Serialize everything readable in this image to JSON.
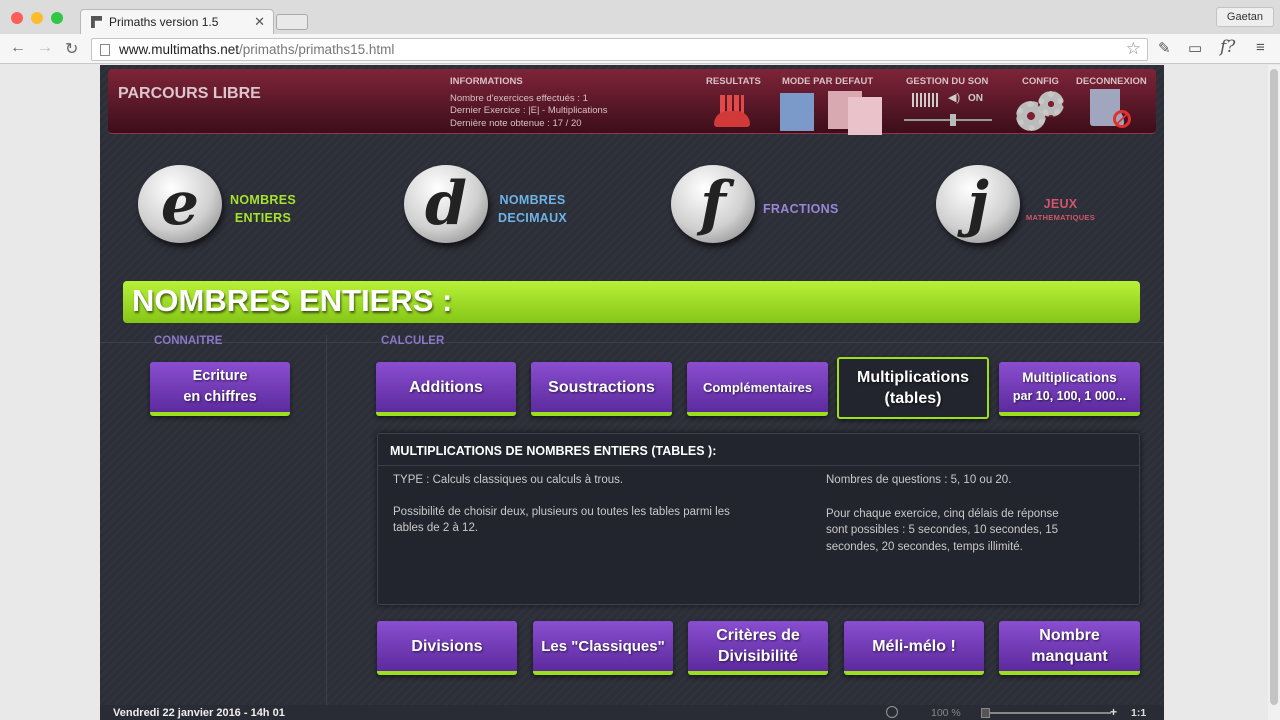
{
  "browser": {
    "tab_title": "Primaths version 1.5",
    "tab_close": "✕",
    "user": "Gaetan",
    "url_host": "www.multimaths.net",
    "url_path": "/primaths/primaths15.html",
    "ext_f": "f?"
  },
  "header": {
    "title": "PARCOURS LIBRE",
    "info_heading": "INFORMATIONS",
    "info_lines": [
      "Nombre d'exercices effectués : 1",
      "Dernier Exercice : |E| - Multiplications",
      "Dernière note obtenue : 17 / 20"
    ],
    "resultats": "RESULTATS",
    "mode": "MODE PAR DEFAUT",
    "son": "GESTION DU SON",
    "son_state": "ON",
    "config": "CONFIG",
    "deconnexion": "DECONNEXION"
  },
  "categories": [
    {
      "letter": "e",
      "line1": "NOMBRES",
      "line2": "ENTIERS",
      "color": "#a6e22e"
    },
    {
      "letter": "d",
      "line1": "NOMBRES",
      "line2": "DECIMAUX",
      "color": "#6fb3e6"
    },
    {
      "letter": "f",
      "line1": "FRACTIONS",
      "line2": "",
      "color": "#9a86d6"
    },
    {
      "letter": "j",
      "line1": "JEUX",
      "line2": "MATHEMATIQUES",
      "color": "#d0566b"
    }
  ],
  "section_title": "NOMBRES ENTIERS :",
  "connaitre": {
    "label": "CONNAITRE",
    "button": [
      "Ecriture",
      "en chiffres"
    ]
  },
  "calculer": {
    "label": "CALCULER",
    "top_buttons": [
      {
        "l1": "Additions",
        "l2": ""
      },
      {
        "l1": "Soustractions",
        "l2": ""
      },
      {
        "l1": "Complémentaires",
        "l2": ""
      },
      {
        "l1": "Multiplications",
        "l2": "(tables)"
      },
      {
        "l1": "Multiplications",
        "l2": "par 10, 100, 1 000..."
      }
    ],
    "bottom_buttons": [
      {
        "l1": "Divisions",
        "l2": ""
      },
      {
        "l1": "Les \"Classiques\"",
        "l2": ""
      },
      {
        "l1": "Critères de",
        "l2": "Divisibilité"
      },
      {
        "l1": "Méli-mélo !",
        "l2": ""
      },
      {
        "l1": "Nombre",
        "l2": "manquant"
      }
    ]
  },
  "panel": {
    "title": "MULTIPLICATIONS DE NOMBRES ENTIERS (TABLES ):",
    "left": [
      "TYPE : Calculs classiques ou calculs à trous.",
      "Possibilité de choisir deux, plusieurs ou toutes les tables parmi les",
      "tables de 2 à 12."
    ],
    "right": [
      "Nombres de questions : 5, 10 ou 20.",
      "Pour chaque exercice, cinq délais de réponse",
      "sont possibles : 5 secondes, 10 secondes, 15",
      "secondes, 20 secondes, temps illimité."
    ]
  },
  "status": {
    "date": "Vendredi 22 janvier 2016 - 14h 01",
    "zoom": "100 %",
    "plus": "+",
    "ratio": "1:1"
  },
  "colors": {
    "accent_green": "#9be01c",
    "button_purple": "#7a3fc2",
    "header_red": "#6a1c2c"
  }
}
